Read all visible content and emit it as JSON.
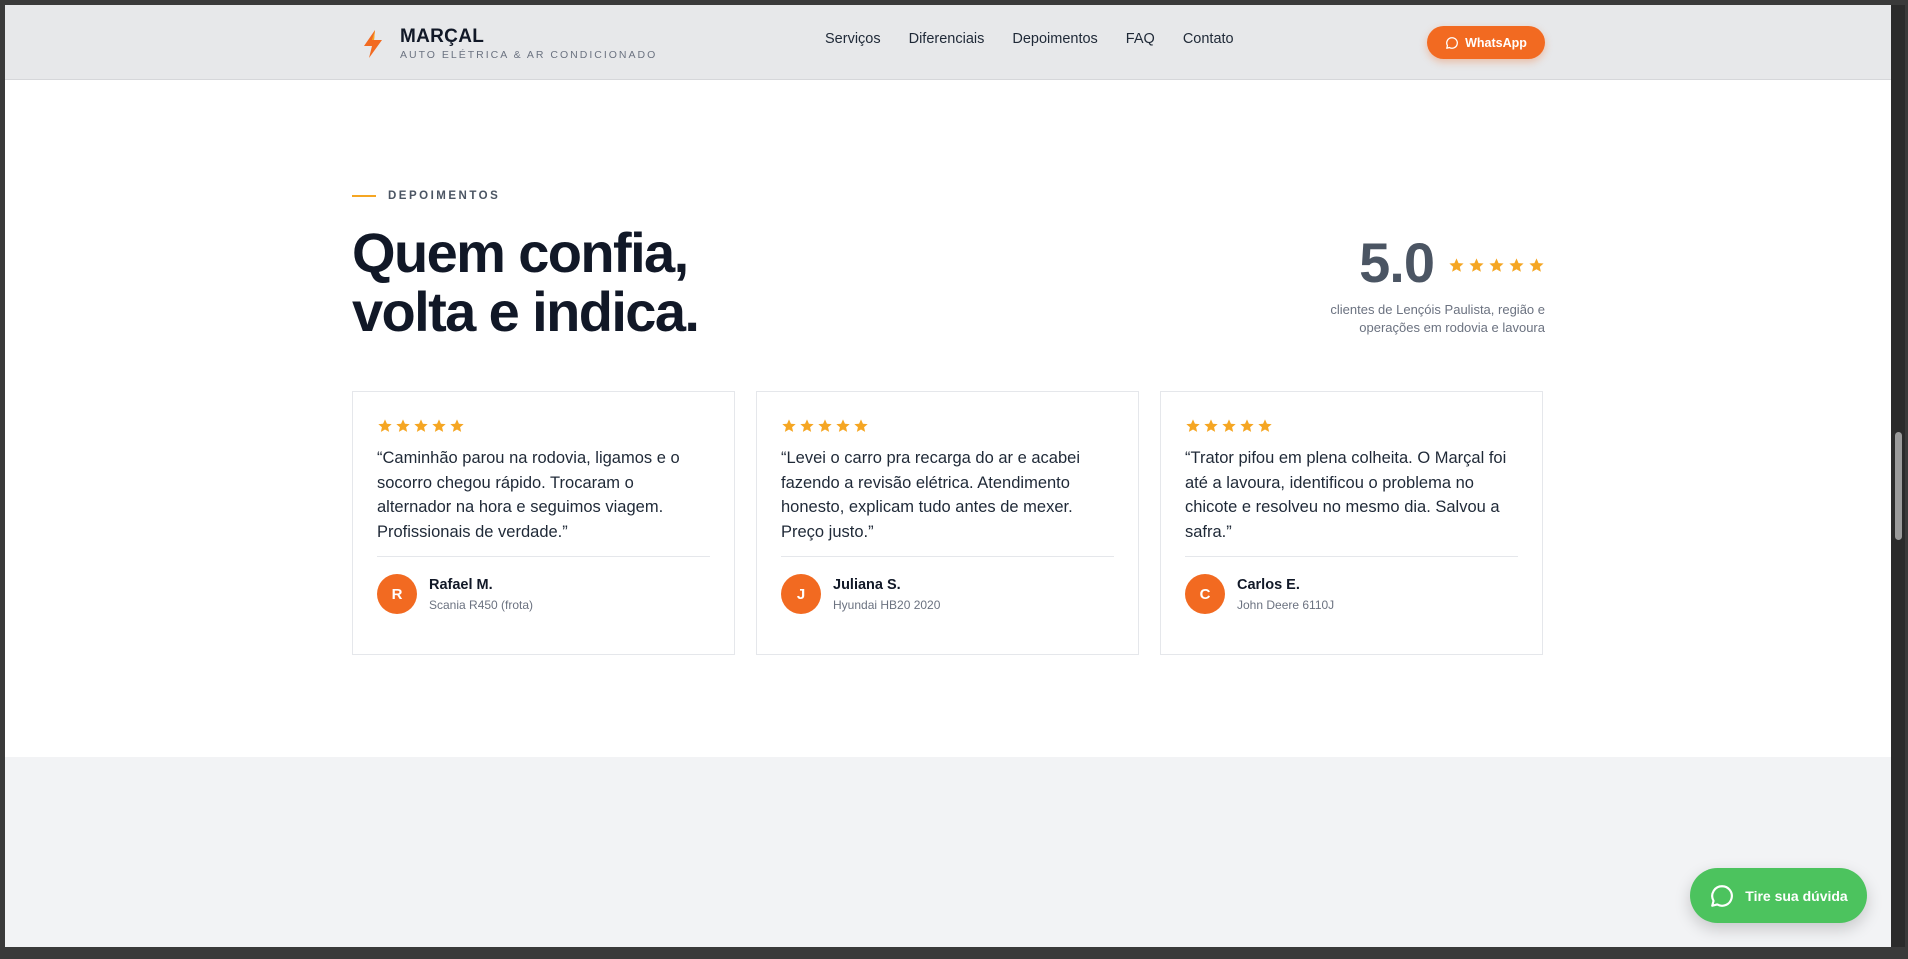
{
  "header": {
    "brand_name": "MARÇAL",
    "brand_tagline": "AUTO ELÉTRICA & AR CONDICIONADO",
    "nav": [
      "Serviços",
      "Diferenciais",
      "Depoimentos",
      "FAQ",
      "Contato"
    ],
    "whatsapp_label": "WhatsApp"
  },
  "section": {
    "eyebrow": "DEPOIMENTOS",
    "headline_line1": "Quem confia,",
    "headline_line2": "volta e indica.",
    "rating_value": "5.0",
    "rating_stars": 5,
    "rating_caption_line1": "clientes de Lençóis Paulista, região e",
    "rating_caption_line2": "operações em rodovia e lavoura"
  },
  "testimonials": [
    {
      "stars": 5,
      "quote": "“Caminhão parou na rodovia, ligamos e o socorro chegou rápido. Trocaram o alternador na hora e seguimos viagem. Profissionais de verdade.”",
      "initial": "R",
      "name": "Rafael M.",
      "detail": "Scania R450 (frota)"
    },
    {
      "stars": 5,
      "quote": "“Levei o carro pra recarga do ar e acabei fazendo a revisão elétrica. Atendimento honesto, explicam tudo antes de mexer. Preço justo.”",
      "initial": "J",
      "name": "Juliana S.",
      "detail": "Hyundai HB20 2020"
    },
    {
      "stars": 5,
      "quote": "“Trator pifou em plena colheita. O Marçal foi até a lavoura, identificou o problema no chicote e resolveu no mesmo dia. Salvou a safra.”",
      "initial": "C",
      "name": "Carlos E.",
      "detail": "John Deere 6110J"
    }
  ],
  "fab": {
    "label": "Tire sua dúvida"
  },
  "colors": {
    "accent": "#f26a21",
    "star": "#f5a623",
    "whatsapp_green": "#4cc35e"
  },
  "icons": [
    "bolt-icon",
    "chat-bubble-icon",
    "star-icon"
  ]
}
